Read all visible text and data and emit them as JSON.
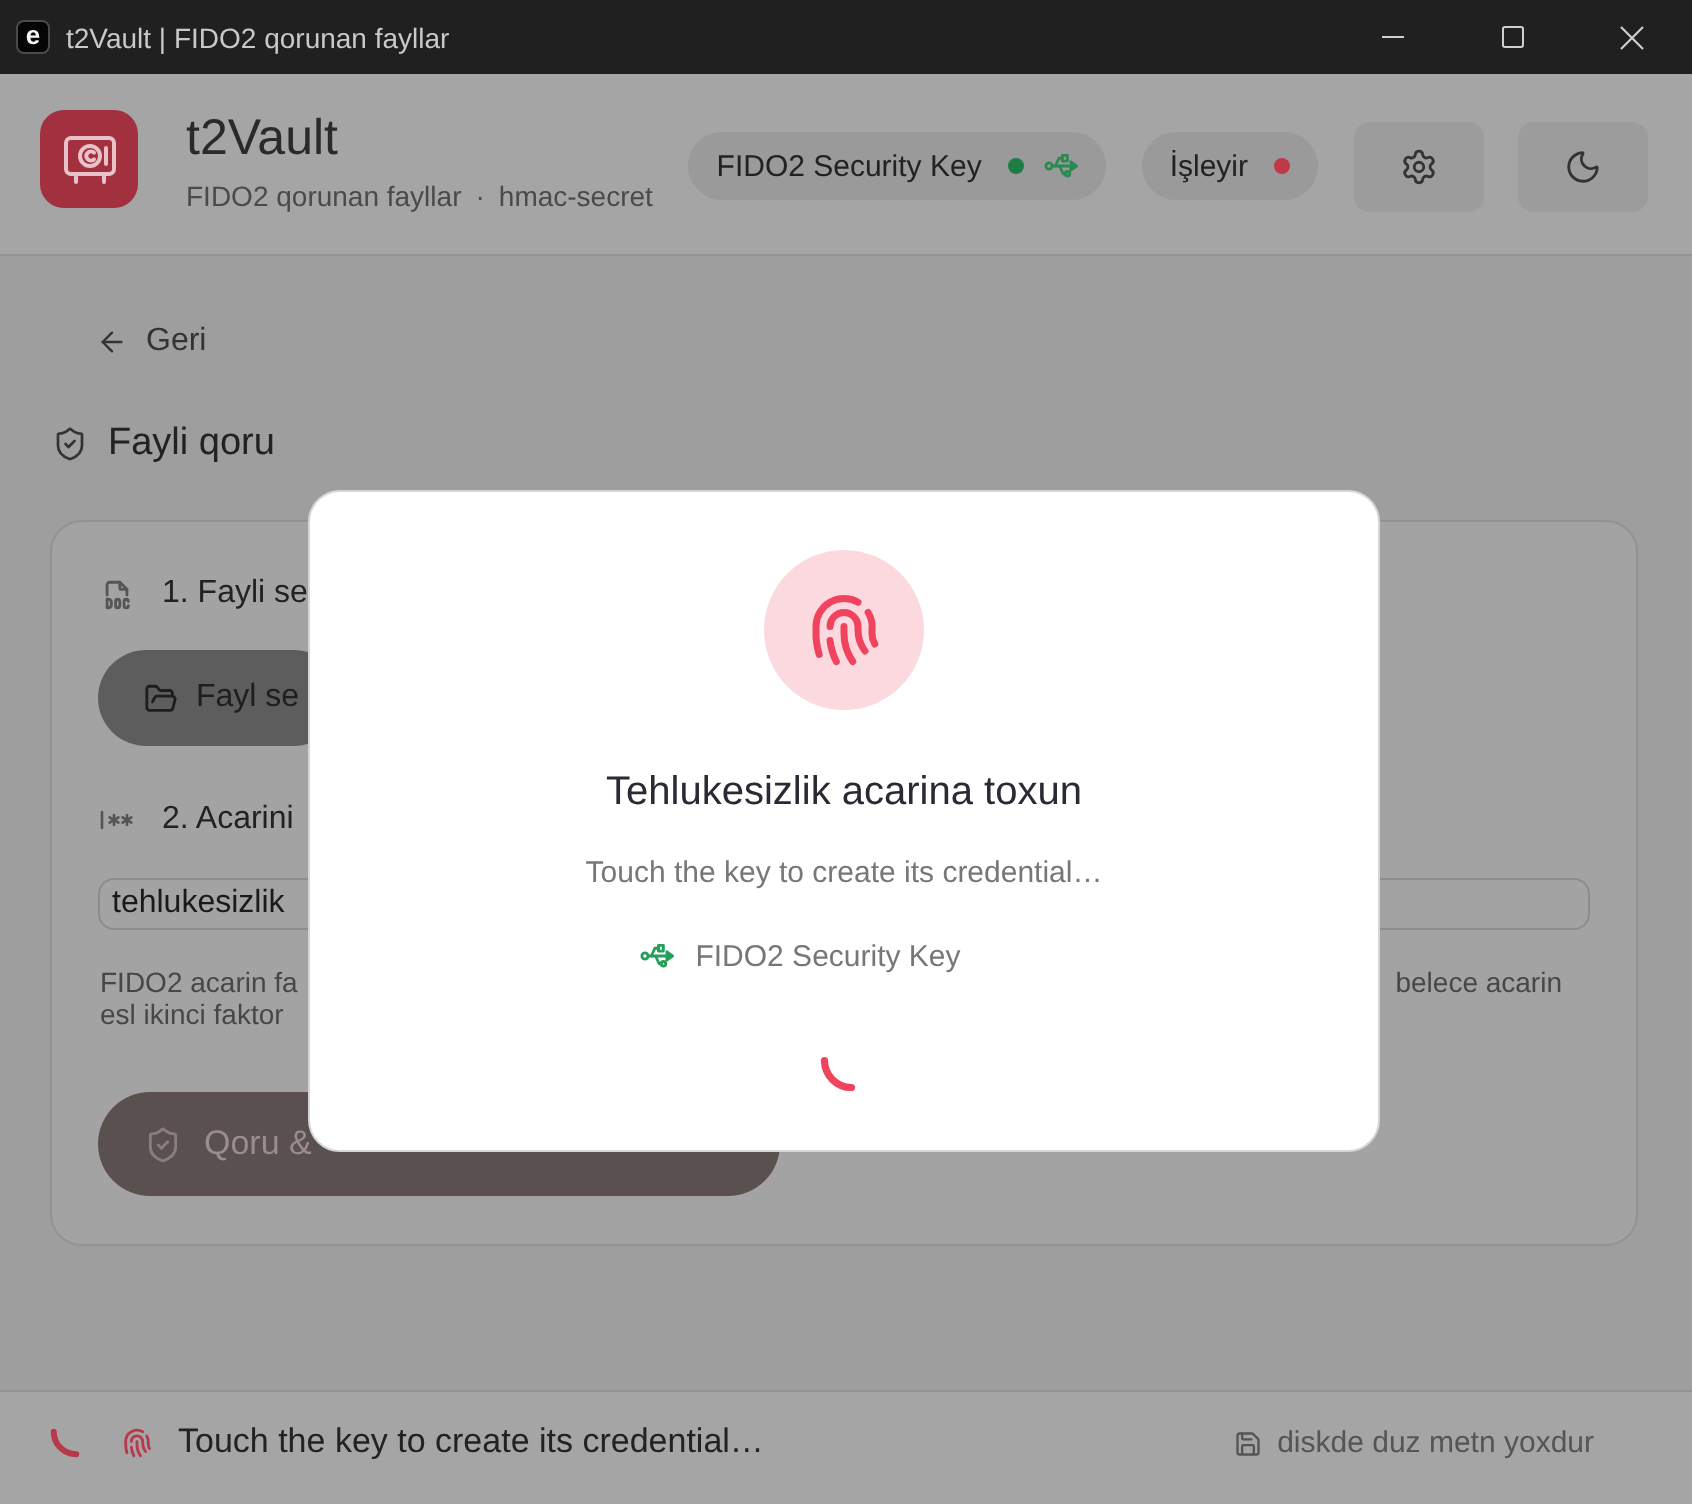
{
  "window": {
    "app_icon_letter": "e",
    "title": "t2Vault | FIDO2 qorunan fayllar"
  },
  "header": {
    "app_name": "t2Vault",
    "subtitle": "FIDO2 qorunan fayllar",
    "subtitle_separator": "·",
    "subtitle_extra": "hmac-secret",
    "chips": [
      {
        "kind": "device",
        "label": "FIDO2 Security Key",
        "color": "#1e7d45"
      },
      {
        "kind": "status",
        "label": "İşleyir",
        "color": "#c0394b"
      }
    ]
  },
  "back": {
    "label": "Geri"
  },
  "page_title": "Fayli qoru",
  "card": {
    "steps": [
      {
        "kind": "file",
        "label": "1. Fayli se",
        "button": "Fayl se"
      },
      {
        "kind": "key",
        "label": "2. Acarini",
        "value": "tehlukesizlik",
        "hint": {
          "line_1_start": "FIDO2 acarin fa",
          "line_1_end": "belece acarin",
          "line_2_start": "esl ikinci faktor"
        }
      }
    ],
    "submit": {
      "label": "Qoru &",
      "disabled": true
    }
  },
  "status_bar": {
    "busy": true,
    "message": "Touch the key to create its credential…",
    "disk_note": "diskde duz metn yoxdur"
  },
  "dialog": {
    "title": "Tehlukesizlik acarina toxun",
    "message": "Touch the key to create its credential…",
    "device": "FIDO2 Security Key",
    "busy": true
  }
}
